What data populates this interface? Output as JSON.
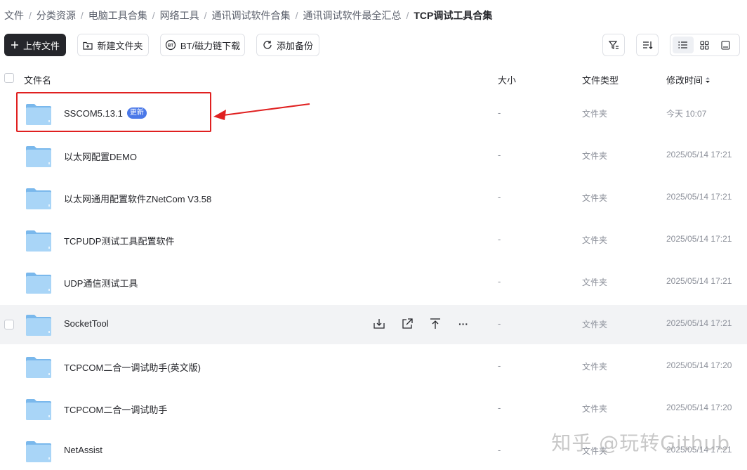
{
  "breadcrumb": [
    "文件",
    "分类资源",
    "电脑工具合集",
    "网络工具",
    "通讯调试软件合集",
    "通讯调试软件最全汇总",
    "TCP调试工具合集"
  ],
  "breadcrumb_sep": "/",
  "toolbar": {
    "upload_label": "上传文件",
    "new_folder_label": "新建文件夹",
    "bt_label": "BT/磁力链下载",
    "backup_label": "添加备份"
  },
  "table_header": {
    "name": "文件名",
    "size": "大小",
    "type": "文件类型",
    "modified": "修改时间"
  },
  "files": [
    {
      "name": "SSCOM5.13.1",
      "badge": "更新",
      "size": "-",
      "type": "文件夹",
      "modified": "今天 10:07"
    },
    {
      "name": "以太网配置DEMO",
      "size": "-",
      "type": "文件夹",
      "modified": "2025/05/14 17:21"
    },
    {
      "name": "以太网通用配置软件ZNetCom V3.58",
      "size": "-",
      "type": "文件夹",
      "modified": "2025/05/14 17:21"
    },
    {
      "name": "TCPUDP测试工具配置软件",
      "size": "-",
      "type": "文件夹",
      "modified": "2025/05/14 17:21"
    },
    {
      "name": "UDP通信测试工具",
      "size": "-",
      "type": "文件夹",
      "modified": "2025/05/14 17:21"
    },
    {
      "name": "SocketTool",
      "size": "-",
      "type": "文件夹",
      "modified": "2025/05/14 17:21"
    },
    {
      "name": "TCPCOM二合一调试助手(英文版)",
      "size": "-",
      "type": "文件夹",
      "modified": "2025/05/14 17:20"
    },
    {
      "name": "TCPCOM二合一调试助手",
      "size": "-",
      "type": "文件夹",
      "modified": "2025/05/14 17:20"
    },
    {
      "name": "NetAssist",
      "size": "-",
      "type": "文件夹",
      "modified": "2025/05/14 17:21"
    }
  ],
  "row_actions": {
    "more": "···"
  },
  "watermark": "知乎 @玩转Github",
  "colors": {
    "accent": "#4a78e8",
    "annotation": "#e02020",
    "primary_button": "#25262b"
  }
}
